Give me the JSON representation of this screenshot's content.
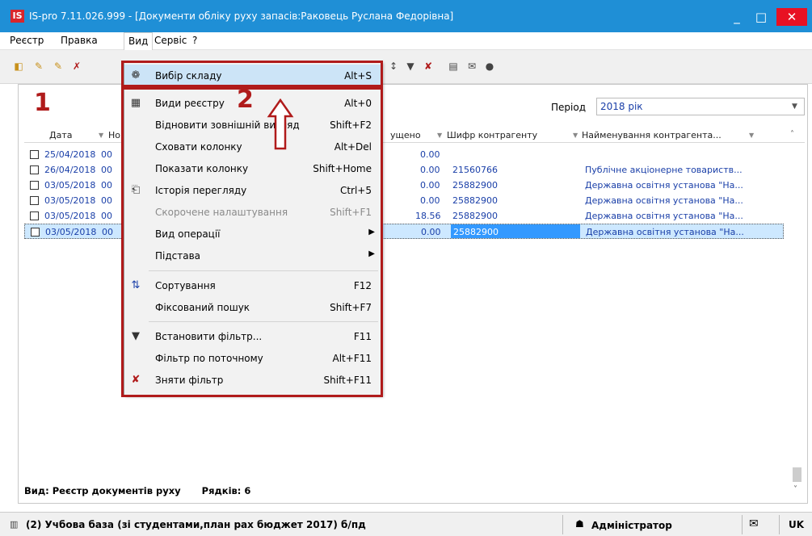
{
  "window": {
    "title": "IS-pro 7.11.026.999 - [Документи обліку руху запасів:Раковець Руслана Федорівна]",
    "logo": "IS",
    "buttons": [
      "_",
      "□",
      "✕"
    ]
  },
  "menubar": [
    "Реєстр",
    "Правка",
    "Вид",
    "Сервіс",
    "?"
  ],
  "period": {
    "label": "Період",
    "value": "2018 рік"
  },
  "grid": {
    "headers": [
      "Дата",
      "Но",
      "ущено",
      "Шифр контрагенту",
      "Найменування контрагента..."
    ],
    "rows": [
      {
        "date": "25/04/2018",
        "no": "00",
        "amount": "0.00",
        "code": "",
        "name": ""
      },
      {
        "date": "26/04/2018",
        "no": "00",
        "amount": "0.00",
        "code": "21560766",
        "name": "Публічне акціонерне товариств..."
      },
      {
        "date": "03/05/2018",
        "no": "00",
        "amount": "0.00",
        "code": "25882900",
        "name": "Державна освітня установа \"На..."
      },
      {
        "date": "03/05/2018",
        "no": "00",
        "amount": "0.00",
        "code": "25882900",
        "name": "Державна освітня установа \"На..."
      },
      {
        "date": "03/05/2018",
        "no": "00",
        "amount": "18.56",
        "code": "25882900",
        "name": "Державна освітня установа \"На..."
      },
      {
        "date": "03/05/2018",
        "no": "00",
        "amount": "0.00",
        "code": "25882900",
        "name": "Державна освітня установа \"На..."
      }
    ]
  },
  "footer": {
    "view": "Вид: Реєстр документів руху",
    "rows": "Рядків: 6"
  },
  "statusbar": {
    "db": "(2) Учбова база (зі студентами,план рах бюджет 2017) б/пд",
    "user": "Адміністратор",
    "lang": "UK"
  },
  "menu": {
    "items": [
      {
        "label": "Вибір складу",
        "shortcut": "Alt+S"
      },
      {
        "label": "Види реєстру",
        "shortcut": "Alt+0"
      },
      {
        "label": "Відновити зовнішній вигляд",
        "shortcut": "Shift+F2"
      },
      {
        "label": "Сховати колонку",
        "shortcut": "Alt+Del"
      },
      {
        "label": "Показати колонку",
        "shortcut": "Shift+Home"
      },
      {
        "label": "Історія перегляду",
        "shortcut": "Ctrl+5"
      },
      {
        "label": "Скорочене налаштування",
        "shortcut": "Shift+F1"
      },
      {
        "label": "Вид операції",
        "shortcut": ""
      },
      {
        "label": "Підстава",
        "shortcut": ""
      },
      {
        "label": "Сортування",
        "shortcut": "F12"
      },
      {
        "label": "Фіксований пошук",
        "shortcut": "Shift+F7"
      },
      {
        "label": "Встановити фільтр...",
        "shortcut": "F11"
      },
      {
        "label": "Фільтр по поточному",
        "shortcut": "Alt+F11"
      },
      {
        "label": "Зняти фільтр",
        "shortcut": "Shift+F11"
      }
    ]
  },
  "annotations": [
    "1",
    "2"
  ],
  "colors": {
    "titlebar": "#1f8fd6",
    "accent_red": "#b01b1b",
    "highlight": "#cce4f7",
    "link_blue": "#1a3fa8"
  }
}
